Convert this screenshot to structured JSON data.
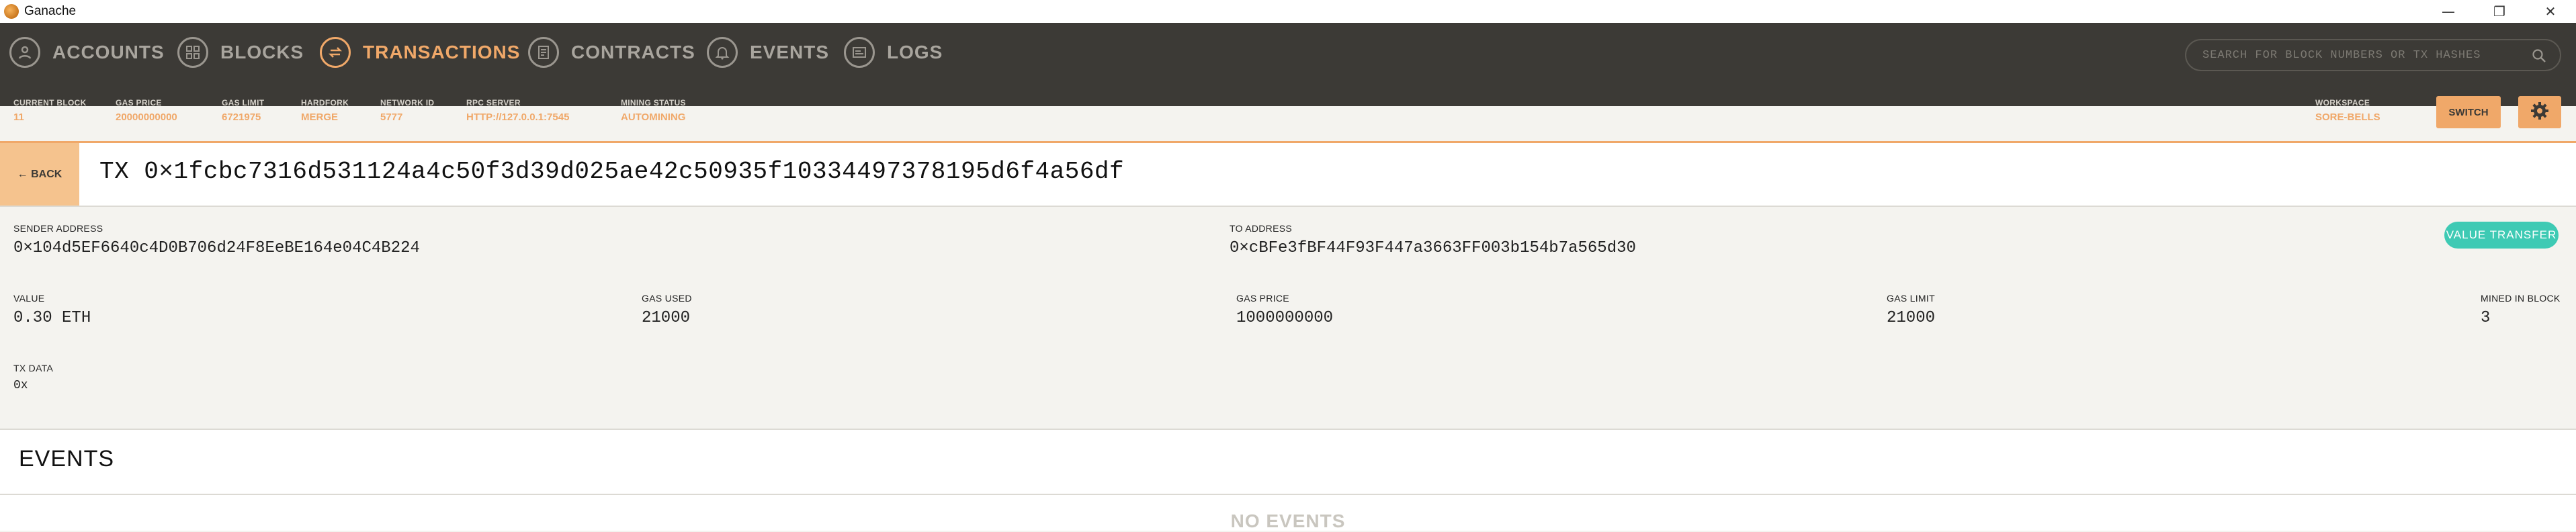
{
  "window": {
    "title": "Ganache",
    "controls": {
      "minimize": "—",
      "maximize": "❐",
      "close": "✕"
    }
  },
  "nav": {
    "items": [
      {
        "label": "ACCOUNTS",
        "icon": "accounts-icon"
      },
      {
        "label": "BLOCKS",
        "icon": "blocks-icon"
      },
      {
        "label": "TRANSACTIONS",
        "icon": "transactions-icon",
        "active": true
      },
      {
        "label": "CONTRACTS",
        "icon": "contracts-icon"
      },
      {
        "label": "EVENTS",
        "icon": "events-icon"
      },
      {
        "label": "LOGS",
        "icon": "logs-icon"
      }
    ],
    "search_placeholder": "SEARCH FOR BLOCK NUMBERS OR TX HASHES"
  },
  "status": {
    "current_block": {
      "label": "CURRENT BLOCK",
      "value": "11"
    },
    "gas_price": {
      "label": "GAS PRICE",
      "value": "20000000000"
    },
    "gas_limit": {
      "label": "GAS LIMIT",
      "value": "6721975"
    },
    "hardfork": {
      "label": "HARDFORK",
      "value": "MERGE"
    },
    "network_id": {
      "label": "NETWORK ID",
      "value": "5777"
    },
    "rpc_server": {
      "label": "RPC SERVER",
      "value": "HTTP://127.0.0.1:7545"
    },
    "mining_status": {
      "label": "MINING STATUS",
      "value": "AUTOMINING"
    },
    "workspace": {
      "label": "WORKSPACE",
      "value": "SORE-BELLS"
    },
    "switch_label": "SWITCH"
  },
  "tx": {
    "back_label": "← BACK",
    "title": "TX 0×1fcbc7316d531124a4c50f3d39d025ae42c50935f10334497378195d6f4a56df",
    "sender": {
      "label": "SENDER ADDRESS",
      "value": "0×104d5EF6640c4D0B706d24F8EeBE164e04C4B224"
    },
    "to": {
      "label": "TO ADDRESS",
      "value": "0×cBFe3fBF44F93F447a3663FF003b154b7a565d30"
    },
    "type_badge": "VALUE TRANSFER",
    "value": {
      "label": "VALUE",
      "value": "0.30 ETH"
    },
    "gas_used": {
      "label": "GAS USED",
      "value": "21000"
    },
    "gas_price": {
      "label": "GAS PRICE",
      "value": "1000000000"
    },
    "gas_limit": {
      "label": "GAS LIMIT",
      "value": "21000"
    },
    "mined_in_block": {
      "label": "MINED IN BLOCK",
      "value": "3"
    },
    "tx_data": {
      "label": "TX DATA",
      "value": "0x"
    }
  },
  "events": {
    "title": "EVENTS",
    "empty_text": "NO EVENTS"
  },
  "colors": {
    "accent": "#f0a869",
    "nav_bg": "#3c3a36",
    "badge": "#3ecab4"
  }
}
